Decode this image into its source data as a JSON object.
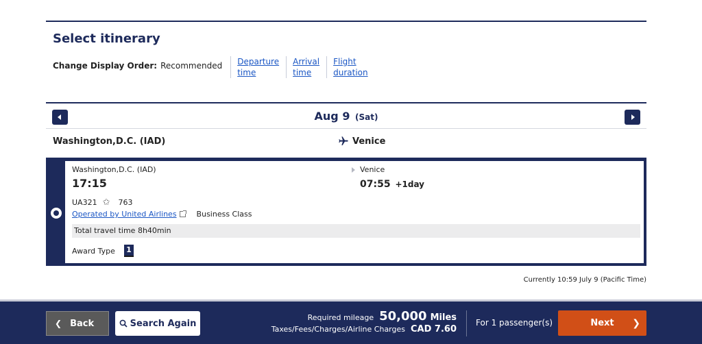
{
  "header": {
    "title": "Select itinerary",
    "order_label": "Change Display Order:",
    "order_current": "Recommended",
    "order_options": [
      {
        "line1": "Departure",
        "line2": "time"
      },
      {
        "line1": "Arrival",
        "line2": "time"
      },
      {
        "line1": "Flight",
        "line2": "duration"
      }
    ]
  },
  "datebar": {
    "date": "Aug 9",
    "day": "(Sat)"
  },
  "route": {
    "origin": "Washington,D.C. (IAD)",
    "destination": "Venice"
  },
  "flight": {
    "dep_city": "Washington,D.C. (IAD)",
    "dep_time": "17:15",
    "arr_city": "Venice",
    "arr_time": "07:55",
    "arr_plus": "+1day",
    "aircraft": "UA321",
    "flight_number": "763",
    "operator": "Operated by United Airlines",
    "cabin": "Business Class",
    "travel_time": "Total travel time 8h40min",
    "award_label": "Award Type",
    "award_value": "1"
  },
  "current_time": "Currently 10:59 July 9 (Pacific Time)",
  "footer": {
    "back_label": "Back",
    "search_label": "Search Again",
    "mileage_label": "Required mileage",
    "mileage_value": "50,000",
    "mileage_unit": "Miles",
    "tax_label": "Taxes/Fees/Charges/Airline Charges",
    "tax_value": "CAD  7.60",
    "passengers": "For 1 passenger(s)",
    "next_label": "Next"
  },
  "colors": {
    "navy": "#1d2a5b",
    "accent": "#d14f17",
    "link": "#1a56c4"
  }
}
